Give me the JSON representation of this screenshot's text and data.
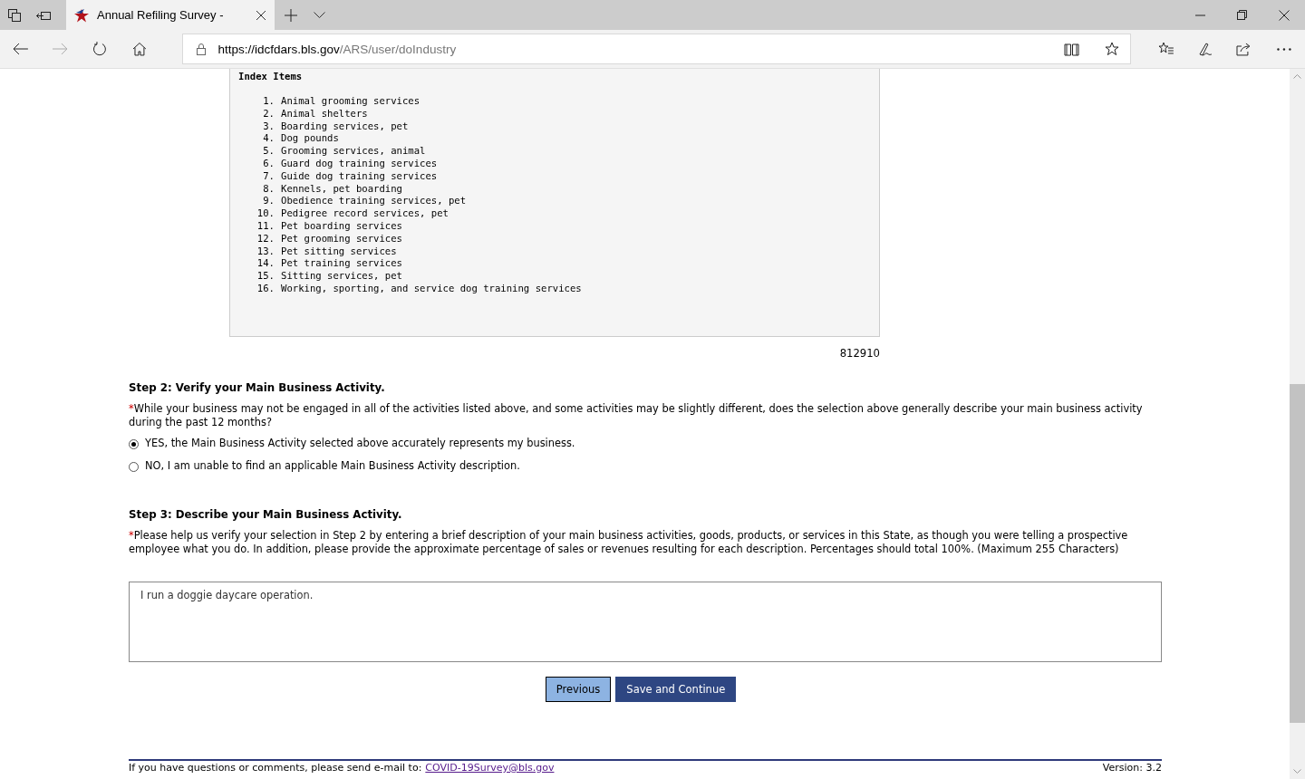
{
  "browser": {
    "tab_title": "Annual Refiling Survey -",
    "url_host": "https://idcfdars.bls.gov",
    "url_path": "/ARS/user/doIndustry"
  },
  "index": {
    "title": "Index Items",
    "items": [
      {
        "number": "1.",
        "text": "Animal grooming services"
      },
      {
        "number": "2.",
        "text": "Animal shelters"
      },
      {
        "number": "3.",
        "text": "Boarding services, pet"
      },
      {
        "number": "4.",
        "text": "Dog pounds"
      },
      {
        "number": "5.",
        "text": "Grooming services, animal"
      },
      {
        "number": "6.",
        "text": "Guard dog training services"
      },
      {
        "number": "7.",
        "text": "Guide dog training services"
      },
      {
        "number": "8.",
        "text": "Kennels, pet boarding"
      },
      {
        "number": "9.",
        "text": "Obedience training services, pet"
      },
      {
        "number": "10.",
        "text": "Pedigree record services, pet"
      },
      {
        "number": "11.",
        "text": "Pet boarding services"
      },
      {
        "number": "12.",
        "text": "Pet grooming services"
      },
      {
        "number": "13.",
        "text": "Pet sitting services"
      },
      {
        "number": "14.",
        "text": "Pet training services"
      },
      {
        "number": "15.",
        "text": "Sitting services, pet"
      },
      {
        "number": "16.",
        "text": "Working, sporting, and service dog training services"
      }
    ],
    "code": "812910"
  },
  "step2": {
    "heading": "Step 2: Verify your Main Business Activity.",
    "required_mark": "*",
    "question": "While your business may not be engaged in all of the activities listed above, and some activities may be slightly different, does the selection above generally describe your main business activity during the past 12 months?",
    "options": [
      {
        "label": "YES, the Main Business Activity selected above accurately represents my business.",
        "selected": true
      },
      {
        "label": "NO, I am unable to find an applicable Main Business Activity description.",
        "selected": false
      }
    ]
  },
  "step3": {
    "heading": "Step 3: Describe your Main Business Activity.",
    "required_mark": "*",
    "instructions": "Please help us verify your selection in Step 2 by entering a brief description of your main business activities, goods, products, or services in this State, as though you were telling a prospective employee what you do. In addition, please provide the approximate percentage of sales or revenues resulting for each description. Percentages should total 100%. (Maximum 255 Characters)",
    "description": "I run a doggie daycare operation."
  },
  "buttons": [
    {
      "label": "Previous",
      "kind": "secondary"
    },
    {
      "label": "Save and Continue",
      "kind": "primary"
    }
  ],
  "footer": {
    "text": "If you have questions or comments, please send e-mail to:",
    "email": "COVID-19Survey@bls.gov",
    "version": "Version: 3.2"
  }
}
